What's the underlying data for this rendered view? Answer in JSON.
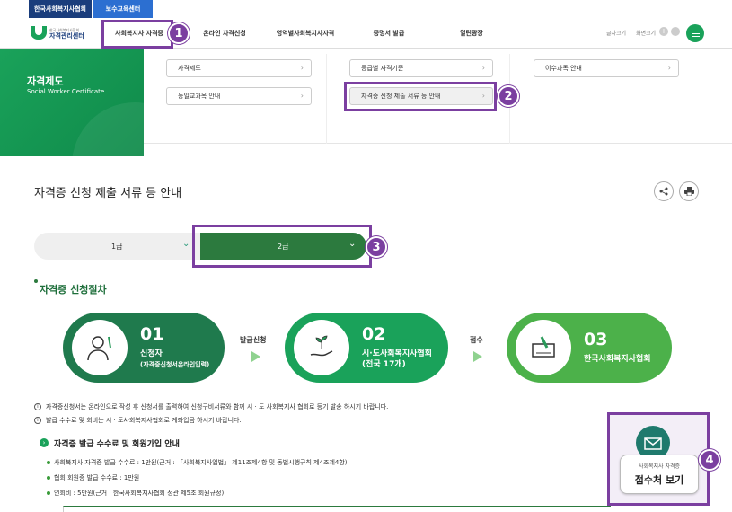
{
  "top_tabs": [
    "한국사회복지사협회",
    "보수교육센터"
  ],
  "logo": {
    "small_text": "한국사회복지사협회",
    "name": "자격관리센터"
  },
  "nav": {
    "items": [
      "사회복지사 자격증",
      "온라인 자격신청",
      "영역별사회복지사자격",
      "증명서 발급",
      "열린광장"
    ],
    "font_link": "글자크기",
    "zoom_label": "화면크기",
    "plus": "+",
    "minus": "−"
  },
  "side_banner": {
    "title": "자격제도",
    "subtitle": "Social Worker Certificate"
  },
  "mega_menu": {
    "col1": [
      "자격제도",
      "동일교과목 안내"
    ],
    "col2": [
      "등급별 자격기준",
      "자격증 신청 제출 서류 등 안내"
    ],
    "col3": [
      "이수과목 안내"
    ]
  },
  "page_title": "자격증 신청 제출 서류 등 안내",
  "grade_tabs": [
    {
      "label": "1급"
    },
    {
      "label": "2급"
    }
  ],
  "section_title": "자격증 신청절차",
  "steps": [
    {
      "num": "01",
      "name": "신청자",
      "sub": "(자격증신청서온라인입력)"
    },
    {
      "num": "02",
      "name": "시·도사회복지사협회",
      "sub": "(전국 17개)"
    },
    {
      "num": "03",
      "name": "한국사회복지사협회",
      "sub": ""
    }
  ],
  "arrows": [
    "발급신청",
    "접수"
  ],
  "notes": [
    "자격증신청서는 온라인으로 작성 후 신청서를 출력하여 신청구비서류와 함께 시 · 도 사회복지사 협회로 등기 발송 하시기 바랍니다.",
    "발급 수수료 및 회비는 시 · 도사회복지사협회로 계좌입금 하시기 바랍니다."
  ],
  "fee_title": "자격증 발급 수수료 및 회원가입 안내",
  "fee_items": [
    "사회복지사 자격증 발급 수수료 : 1만원(근거 : 「사회복지사업법」 제11조제4항 및 동법시행규칙 제4조제4항)",
    "협회 회원증 발급 수수료 : 1만원",
    "연회비 : 5만원(근거 : 한국사회복지사협회 정관 제5조 회원규정)"
  ],
  "float_widget": {
    "label": "사회복지사 자격증",
    "button": "접수처 보기"
  },
  "annotations": [
    "1",
    "2",
    "3",
    "4"
  ],
  "colors": {
    "green_dark": "#1f7a4d",
    "green_mid": "#1aa25a",
    "green_light": "#4cb14a",
    "purple": "#7b3fa0"
  }
}
